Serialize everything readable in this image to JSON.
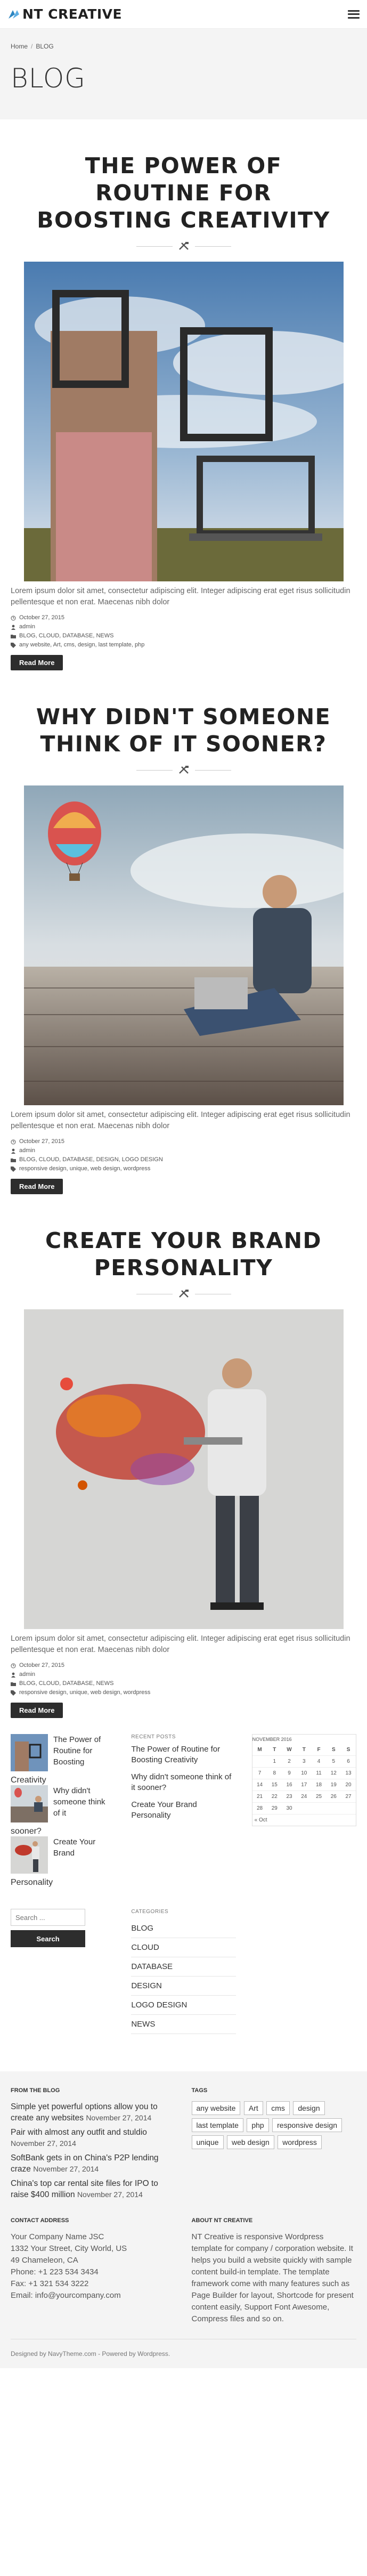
{
  "header": {
    "logo_text": "NT CREATIVE",
    "menu_icon": "menu-icon"
  },
  "breadcrumb": {
    "home": "Home",
    "separator": "/",
    "current": "BLOG"
  },
  "page_title": "BLOG",
  "posts": [
    {
      "title": "THE POWER OF ROUTINE FOR BOOSTING CREATIVITY",
      "excerpt": "Lorem ipsum dolor sit amet, consectetur adipiscing elit. Integer adipiscing erat eget risus sollicitudin pellentesque et non erat. Maecenas nibh dolor",
      "date": "October 27, 2015",
      "author": "admin",
      "categories": "BLOG, CLOUD, DATABASE, NEWS",
      "tags": "any website, Art, cms, design, last template, php",
      "read_more": "Read More"
    },
    {
      "title": "WHY DIDN'T SOMEONE THINK OF IT SOONER?",
      "excerpt": "Lorem ipsum dolor sit amet, consectetur adipiscing elit. Integer adipiscing erat eget risus sollicitudin pellentesque et non erat. Maecenas nibh dolor",
      "date": "October 27, 2015",
      "author": "admin",
      "categories": "BLOG, CLOUD, DATABASE, DESIGN, LOGO DESIGN",
      "tags": "responsive design, unique, web design, wordpress",
      "read_more": "Read More"
    },
    {
      "title": "CREATE YOUR BRAND PERSONALITY",
      "excerpt": "Lorem ipsum dolor sit amet, consectetur adipiscing elit. Integer adipiscing erat eget risus sollicitudin pellentesque et non erat. Maecenas nibh dolor",
      "date": "October 27, 2015",
      "author": "admin",
      "categories": "BLOG, CLOUD, DATABASE, NEWS",
      "tags": "responsive design, unique, web design, wordpress",
      "read_more": "Read More"
    }
  ],
  "sidebar": {
    "thumb_posts": [
      {
        "title": "The Power of Routine for Boosting",
        "tail": "Creativity"
      },
      {
        "title": "Why didn't someone think of it",
        "tail": "sooner?"
      },
      {
        "title": "Create Your Brand",
        "tail": "Personality"
      }
    ],
    "recent_title": "RECENT POSTS",
    "recent": [
      "The Power of Routine for Boosting Creativity",
      "Why didn't someone think of it sooner?",
      "Create Your Brand Personality"
    ],
    "calendar": {
      "caption": "NOVEMBER 2016",
      "days": [
        "M",
        "T",
        "W",
        "T",
        "F",
        "S",
        "S"
      ],
      "rows": [
        [
          "",
          "1",
          "2",
          "3",
          "4",
          "5",
          "6"
        ],
        [
          "7",
          "8",
          "9",
          "10",
          "11",
          "12",
          "13"
        ],
        [
          "14",
          "15",
          "16",
          "17",
          "18",
          "19",
          "20"
        ],
        [
          "21",
          "22",
          "23",
          "24",
          "25",
          "26",
          "27"
        ],
        [
          "28",
          "29",
          "30",
          "",
          "",
          "",
          ""
        ]
      ],
      "prev": "« Oct"
    },
    "search_placeholder": "Search ...",
    "search_button": "Search",
    "categories_title": "CATEGORIES",
    "categories": [
      "BLOG",
      "CLOUD",
      "DATABASE",
      "DESIGN",
      "LOGO DESIGN",
      "NEWS"
    ]
  },
  "footer": {
    "blog_title": "FROM THE BLOG",
    "news": [
      {
        "text": "Simple yet powerful options allow you to create any websites",
        "date": "November 27, 2014"
      },
      {
        "text": "Pair with almost any outfit and stuldio",
        "date": "November 27, 2014"
      },
      {
        "text": "SoftBank gets in on China's P2P lending craze",
        "date": "November 27, 2014"
      },
      {
        "text": "China's top car rental site files for IPO to raise $400 million",
        "date": "November 27, 2014"
      }
    ],
    "tags_title": "TAGS",
    "tags": [
      "any website",
      "Art",
      "cms",
      "design",
      "last template",
      "php",
      "responsive design",
      "unique",
      "web design",
      "wordpress"
    ],
    "contact_title": "CONTACT ADDRESS",
    "contact": [
      "Your Company Name JSC",
      "1332 Your Street, City World, US",
      "49 Chameleon, CA",
      "Phone: +1 223 534 3434",
      "Fax: +1 321 534 3222",
      "Email: info@yourcompany.com"
    ],
    "about_title": "ABOUT NT CREATIVE",
    "about": "NT Creative is responsive Wordpress template for company / corporation website. It helps you build a website quickly with sample content build-in template. The template framework come with many features such as Page Builder for layout, Shortcode for present content easily, Support Font Awesome, Compress files and so on.",
    "copyright": "Designed by NavyTheme.com - Powered by Wordpress."
  }
}
